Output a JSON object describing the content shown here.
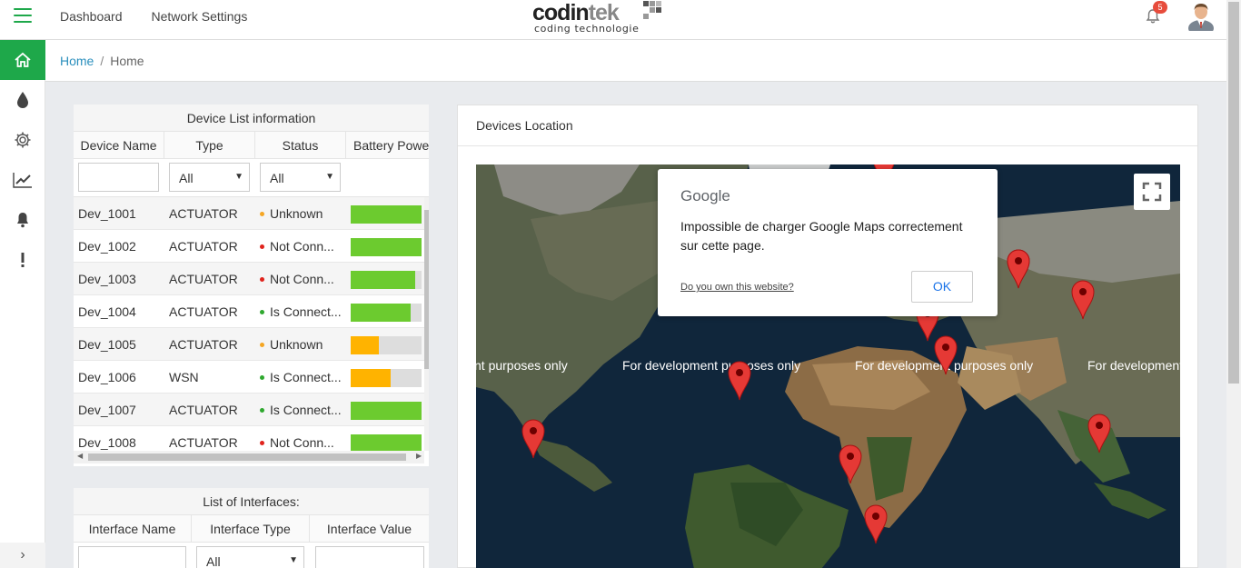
{
  "header": {
    "nav": [
      "Dashboard",
      "Network Settings"
    ],
    "logo_main": "codin",
    "logo_accent": "tek",
    "logo_sub": "coding technologie",
    "notification_count": "5"
  },
  "sidebar": {
    "items": [
      "home-icon",
      "drop-icon",
      "gear-icon",
      "chart-icon",
      "bell-icon",
      "alert-icon"
    ],
    "active": "home-icon",
    "expand_glyph": "›"
  },
  "breadcrumb": {
    "link": "Home",
    "separator": "/",
    "current": "Home"
  },
  "device_list": {
    "title": "Device List information",
    "columns": [
      "Device Name",
      "Type",
      "Status",
      "Battery Power"
    ],
    "type_filter": "All",
    "status_filter": "All",
    "rows": [
      {
        "name": "Dev_1001",
        "type": "ACTUATOR",
        "status": "Unknown",
        "status_color": "#f5a623",
        "battery": 1.0,
        "battery_color": "#6ccb2f"
      },
      {
        "name": "Dev_1002",
        "type": "ACTUATOR",
        "status": "Not Conn...",
        "status_color": "#e0231c",
        "battery": 1.0,
        "battery_color": "#6ccb2f"
      },
      {
        "name": "Dev_1003",
        "type": "ACTUATOR",
        "status": "Not Conn...",
        "status_color": "#e0231c",
        "battery": 0.91,
        "battery_color": "#6ccb2f"
      },
      {
        "name": "Dev_1004",
        "type": "ACTUATOR",
        "status": "Is Connect...",
        "status_color": "#2ea82e",
        "battery": 0.84,
        "battery_color": "#6ccb2f"
      },
      {
        "name": "Dev_1005",
        "type": "ACTUATOR",
        "status": "Unknown",
        "status_color": "#f5a623",
        "battery": 0.4,
        "battery_color": "#ffb300"
      },
      {
        "name": "Dev_1006",
        "type": "WSN",
        "status": "Is Connect...",
        "status_color": "#2ea82e",
        "battery": 0.57,
        "battery_color": "#ffb300"
      },
      {
        "name": "Dev_1007",
        "type": "ACTUATOR",
        "status": "Is Connect...",
        "status_color": "#2ea82e",
        "battery": 1.0,
        "battery_color": "#6ccb2f"
      },
      {
        "name": "Dev_1008",
        "type": "ACTUATOR",
        "status": "Not Conn...",
        "status_color": "#e0231c",
        "battery": 1.0,
        "battery_color": "#6ccb2f"
      }
    ]
  },
  "interfaces": {
    "title": "List of Interfaces:",
    "columns": [
      "Interface Name",
      "Interface Type",
      "Interface Value"
    ],
    "type_filter": "All"
  },
  "map": {
    "title": "Devices Location",
    "watermark": [
      "nt purposes only",
      "For development purposes only",
      "For development purposes only",
      "For development"
    ],
    "dialog": {
      "brand": "Google",
      "message": "Impossible de charger Google Maps correctement sur cette page.",
      "own_link": "Do you own this website?",
      "ok": "OK"
    }
  }
}
